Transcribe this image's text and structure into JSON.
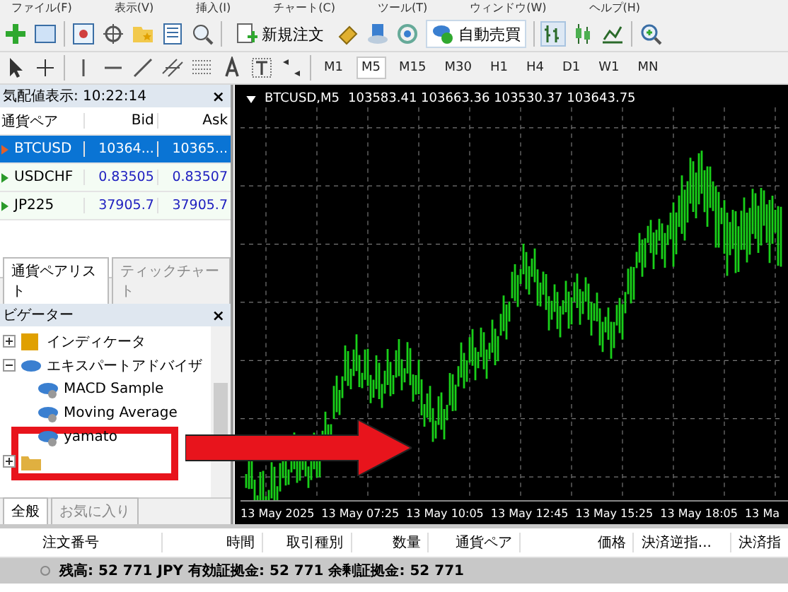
{
  "menu": [
    "ファイル(F)",
    "表示(V)",
    "挿入(I)",
    "チャート(C)",
    "ツール(T)",
    "ウィンドウ(W)",
    "ヘルプ(H)"
  ],
  "toolbar": {
    "new_order": "新規注文",
    "auto_trading": "自動売買",
    "auto_trading_on": true
  },
  "timeframes": [
    {
      "label": "M1",
      "selected": false
    },
    {
      "label": "M5",
      "selected": true
    },
    {
      "label": "M15",
      "selected": false
    },
    {
      "label": "M30",
      "selected": false
    },
    {
      "label": "H1",
      "selected": false
    },
    {
      "label": "H4",
      "selected": false
    },
    {
      "label": "D1",
      "selected": false
    },
    {
      "label": "W1",
      "selected": false
    },
    {
      "label": "MN",
      "selected": false
    }
  ],
  "market_watch": {
    "title": "気配値表示: 10:22:14",
    "columns": [
      "通貨ペア",
      "Bid",
      "Ask"
    ],
    "close": "×",
    "rows": [
      {
        "symbol": "BTCUSD",
        "bid": "10364...",
        "ask": "10365...",
        "rising": false,
        "selected": true
      },
      {
        "symbol": "USDCHF",
        "bid": "0.83505",
        "ask": "0.83507",
        "rising": true,
        "selected": false
      },
      {
        "symbol": "JP225",
        "bid": "37905.7",
        "ask": "37905.7",
        "rising": true,
        "selected": false
      }
    ],
    "tabs": [
      {
        "label": "通貨ペアリスト",
        "selected": true
      },
      {
        "label": "ティックチャート",
        "selected": false
      }
    ]
  },
  "navigator": {
    "title": "ビゲーター",
    "close": "×",
    "tree": [
      {
        "label": "インディケータ",
        "kind": "indicator",
        "expanded": false
      },
      {
        "label": "エキスパートアドバイザ",
        "kind": "expert",
        "expanded": true,
        "children": [
          {
            "label": "MACD Sample",
            "kind": "expert"
          },
          {
            "label": "Moving Average",
            "kind": "expert"
          },
          {
            "label": "yamato",
            "kind": "expert"
          }
        ]
      },
      {
        "kind": "script",
        "expanded": false
      }
    ],
    "tabs": [
      {
        "label": "全般",
        "selected": true
      },
      {
        "label": "お気に入り",
        "selected": false
      }
    ]
  },
  "chart": {
    "title": "BTCUSD,M5",
    "ohlc": "103583.41 103663.36 103530.37 103643.75",
    "time_labels": [
      "13 May 2025",
      "13 May 07:25",
      "13 May 10:05",
      "13 May 12:45",
      "13 May 15:25",
      "13 May 18:05",
      "13 Ma"
    ]
  },
  "terminal": {
    "columns": [
      "注文番号",
      "時間",
      "取引種別",
      "数量",
      "通貨ペア",
      "価格",
      "決済逆指...",
      "決済指"
    ],
    "balance_line": "残高: 52 771 JPY  有効証拠金: 52 771  余剰証拠金: 52 771"
  }
}
